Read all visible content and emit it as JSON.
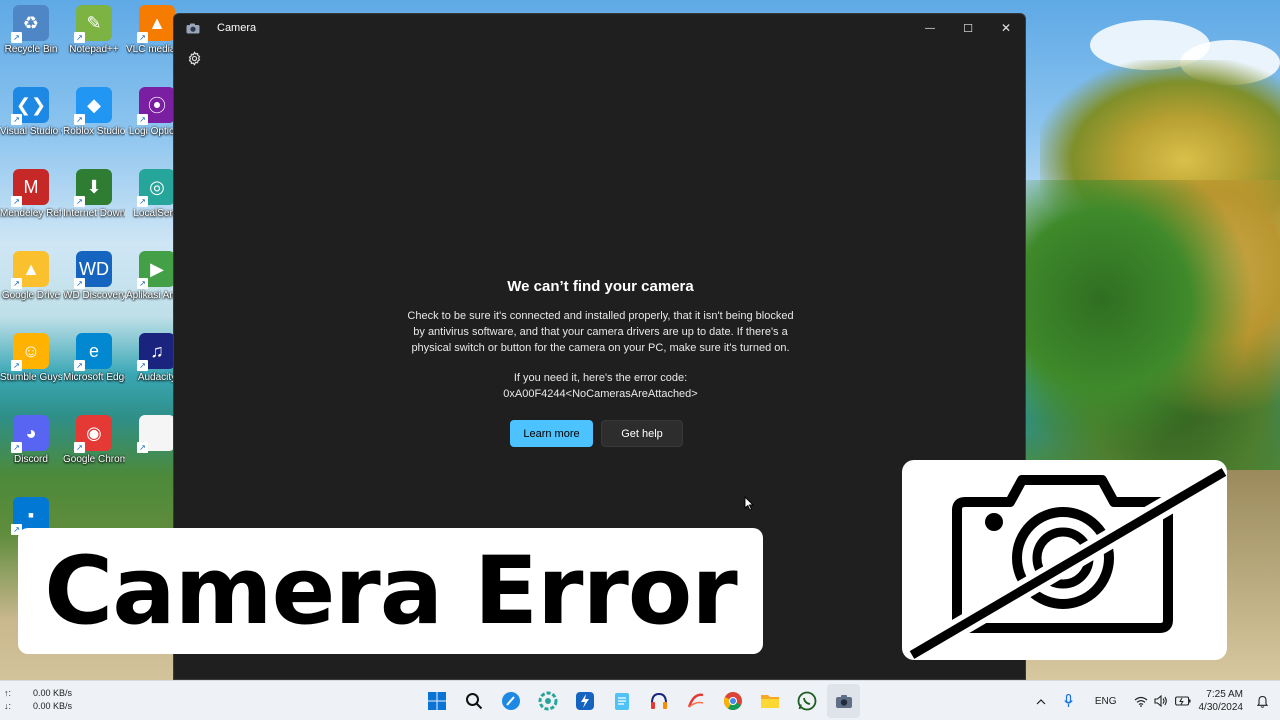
{
  "desktop": {
    "icons": [
      {
        "label": "Recycle Bin",
        "icon": "recycle-bin-icon",
        "color": "#4f86c6"
      },
      {
        "label": "Notepad++",
        "icon": "notepadpp-icon",
        "color": "#7cb342"
      },
      {
        "label": "VLC media player",
        "icon": "vlc-icon",
        "color": "#f57c00"
      },
      {
        "label": "Visual Studio Code",
        "icon": "vscode-icon",
        "color": "#1e88e5"
      },
      {
        "label": "Roblox Studio",
        "icon": "roblox-studio-icon",
        "color": "#2196f3"
      },
      {
        "label": "Logi Options",
        "icon": "logi-icon",
        "color": "#7b1fa2"
      },
      {
        "label": "Mendeley Referen...",
        "icon": "mendeley-icon",
        "color": "#c62828"
      },
      {
        "label": "Internet Downloa...",
        "icon": "idm-icon",
        "color": "#2e7d32"
      },
      {
        "label": "LocalSend",
        "icon": "localsend-icon",
        "color": "#26a69a"
      },
      {
        "label": "Google Drive",
        "icon": "google-drive-icon",
        "color": "#fbc02d"
      },
      {
        "label": "WD Discovery",
        "icon": "wd-icon",
        "color": "#1565c0"
      },
      {
        "label": "Aplikasi Android",
        "icon": "play-store-icon",
        "color": "#43a047"
      },
      {
        "label": "Stumble Guys",
        "icon": "stumble-guys-icon",
        "color": "#ffb300"
      },
      {
        "label": "Microsoft Edge",
        "icon": "edge-icon",
        "color": "#0288d1"
      },
      {
        "label": "Audacity",
        "icon": "audacity-icon",
        "color": "#1a237e"
      },
      {
        "label": "Discord",
        "icon": "discord-icon",
        "color": "#5865f2"
      },
      {
        "label": "Google Chrome",
        "icon": "chrome-icon",
        "color": "#e53935"
      },
      {
        "label": "",
        "icon": "file-icon",
        "color": "#f5f5f5"
      },
      {
        "label": "",
        "icon": "app-icon",
        "color": "#0078d4"
      }
    ]
  },
  "window": {
    "title": "Camera",
    "minimize_glyph": "—",
    "maximize_glyph": "☐",
    "close_glyph": "✕"
  },
  "error": {
    "title": "We can’t find your camera",
    "body_lines": [
      "Check to be sure it's connected and installed properly, that it isn't being blocked",
      "by antivirus software, and that your camera drivers are up to date. If there's a",
      "physical switch or button for the camera on your PC, make sure it's turned on."
    ],
    "code_intro": "If you need it, here's the error code:",
    "code": "0xA00F4244<NoCamerasAreAttached>",
    "learn_more": "Learn more",
    "get_help": "Get help",
    "accent": "#4cc2ff"
  },
  "overlay": {
    "banner_text": "Camera Error",
    "icon": "camera-off-icon"
  },
  "taskbar": {
    "upload": "0.00 KB/s",
    "download": "0.00 KB/s",
    "upload_arrow": "↑:",
    "download_arrow": "↓:",
    "language": "ENG",
    "time": "7:25 AM",
    "date": "4/30/2024",
    "apps": [
      "start-icon",
      "search-icon",
      "app-blue-icon",
      "app-green-icon",
      "app-lightning-icon",
      "notepad-icon",
      "headphones-icon",
      "app-pen-icon",
      "chrome-icon",
      "file-explorer-icon",
      "whatsapp-icon",
      "camera-icon"
    ]
  }
}
